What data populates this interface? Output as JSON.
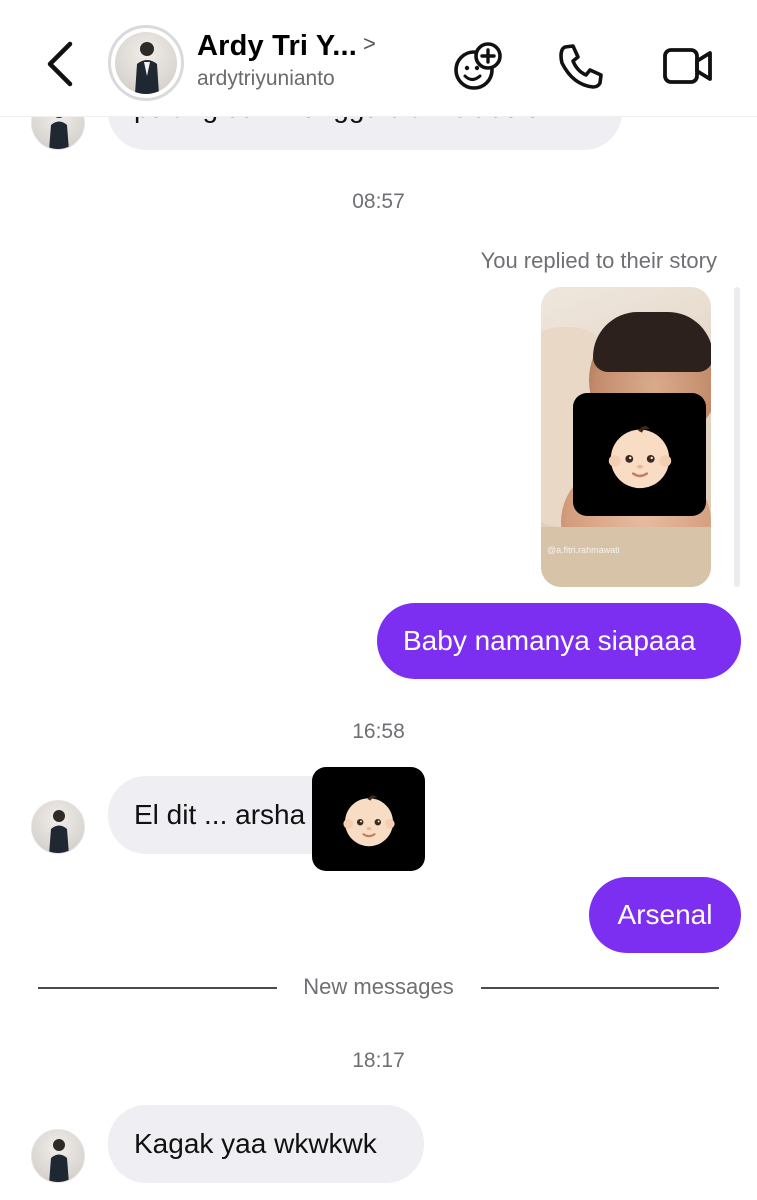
{
  "header": {
    "title": "Ardy Tri Y...",
    "username": "ardytriyunianto",
    "icons": [
      "back-chevron-icon",
      "games-icon",
      "phone-icon",
      "video-icon"
    ]
  },
  "messages": {
    "partial_text": "pulang dtl... nunggu dia visit dulu",
    "time_1": "08:57",
    "replied_label": "You replied to their story",
    "story_watermark": "@a.fitri.rahmawati",
    "out_1": "Baby namanya siapaaa",
    "time_2": "16:58",
    "in_1": "El dit ... arsha",
    "out_2": "Arsenal",
    "new_messages": "New messages",
    "time_3": "18:17",
    "in_2": "Kagak yaa wkwkwk"
  },
  "colors": {
    "outgoing_bubble": "#7c2ff0",
    "incoming_bubble": "#efeff3",
    "meta_text": "#6f6f74"
  }
}
